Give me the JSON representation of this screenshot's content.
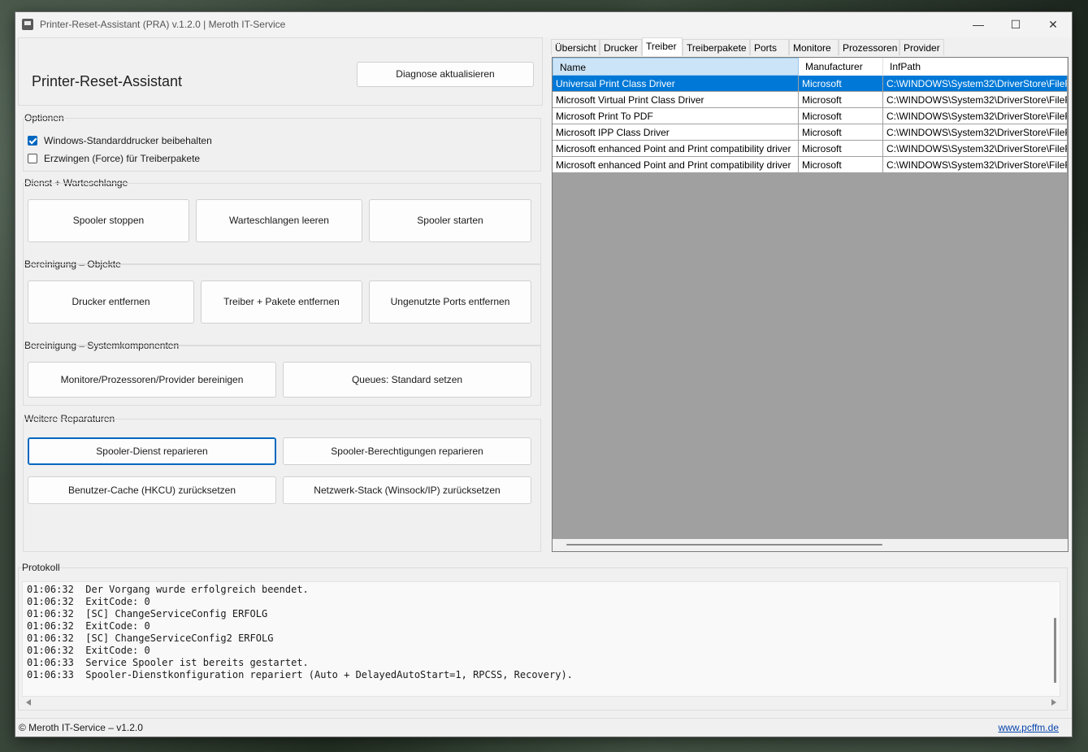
{
  "window": {
    "title": "Printer-Reset-Assistant (PRA) v.1.2.0 | Meroth IT-Service",
    "min_glyph": "—",
    "max_glyph": "☐",
    "close_glyph": "✕"
  },
  "header": {
    "app_name": "Printer-Reset-Assistant",
    "refresh_label": "Diagnose aktualisieren"
  },
  "options": {
    "label": "Optionen",
    "keep_default": {
      "label": "Windows-Standarddrucker beibehalten",
      "checked": true
    },
    "force_packages": {
      "label": "Erzwingen (Force) für Treiberpakete",
      "checked": false
    }
  },
  "service": {
    "label": "Dienst + Warteschlange",
    "stop": "Spooler stoppen",
    "clear": "Warteschlangen leeren",
    "start": "Spooler starten"
  },
  "cleanup_objects": {
    "label": "Bereinigung – Objekte",
    "remove_printers": "Drucker entfernen",
    "remove_drivers": "Treiber + Pakete entfernen",
    "remove_ports": "Ungenutzte Ports entfernen"
  },
  "cleanup_system": {
    "label": "Bereinigung – Systemkomponenten",
    "clean_monitors": "Monitore/Prozessoren/Provider bereinigen",
    "queues_default": "Queues: Standard setzen"
  },
  "repairs": {
    "label": "Weitere Reparaturen",
    "repair_service": "Spooler-Dienst reparieren",
    "repair_permissions": "Spooler-Berechtigungen reparieren",
    "reset_cache": "Benutzer-Cache (HKCU) zurücksetzen",
    "reset_network": "Netzwerk-Stack (Winsock/IP) zurücksetzen"
  },
  "tabs": [
    "Übersicht",
    "Drucker",
    "Treiber",
    "Treiberpakete",
    "Ports",
    "Monitore",
    "Prozessoren",
    "Provider"
  ],
  "active_tab": "Treiber",
  "grid": {
    "columns": [
      "Name",
      "Manufacturer",
      "InfPath"
    ],
    "rows": [
      [
        "Universal Print Class Driver",
        "Microsoft",
        "C:\\WINDOWS\\System32\\DriverStore\\FileRe"
      ],
      [
        "Microsoft Virtual Print Class Driver",
        "Microsoft",
        "C:\\WINDOWS\\System32\\DriverStore\\FileRe"
      ],
      [
        "Microsoft Print To PDF",
        "Microsoft",
        "C:\\WINDOWS\\System32\\DriverStore\\FileRe"
      ],
      [
        "Microsoft IPP Class Driver",
        "Microsoft",
        "C:\\WINDOWS\\System32\\DriverStore\\FileRe"
      ],
      [
        "Microsoft enhanced Point and Print compatibility driver",
        "Microsoft",
        "C:\\WINDOWS\\System32\\DriverStore\\FileRe"
      ],
      [
        "Microsoft enhanced Point and Print compatibility driver",
        "Microsoft",
        "C:\\WINDOWS\\System32\\DriverStore\\FileRe"
      ]
    ],
    "selected_row": 0
  },
  "log": {
    "label": "Protokoll",
    "lines": [
      "01:06:32  Der Vorgang wurde erfolgreich beendet.",
      "01:06:32  ExitCode: 0",
      "01:06:32  [SC] ChangeServiceConfig ERFOLG",
      "01:06:32  ExitCode: 0",
      "01:06:32  [SC] ChangeServiceConfig2 ERFOLG",
      "01:06:32  ExitCode: 0",
      "01:06:33  Service Spooler ist bereits gestartet.",
      "01:06:33  Spooler-Dienstkonfiguration repariert (Auto + DelayedAutoStart=1, RPCSS, Recovery)."
    ]
  },
  "status": {
    "copyright": "© Meroth IT-Service – v1.2.0",
    "link": "www.pcffm.de"
  },
  "colors": {
    "accent": "#0067c0",
    "selection": "#0078d7",
    "header_selected": "#cce4f7"
  }
}
